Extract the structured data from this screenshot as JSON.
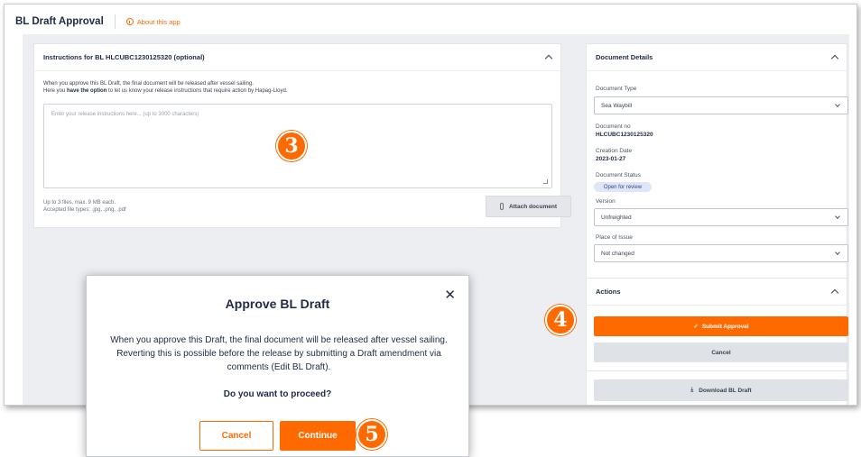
{
  "app": {
    "title": "BL Draft Approval",
    "about_link": "About this app",
    "accent_color": "#ff6a00"
  },
  "instructions": {
    "header": "Instructions for BL HLCUBC1230125320 (optional)",
    "line1": "When you approve this BL Draft, the final document will be released after vessel sailing.",
    "line2_pre": "Here you ",
    "line2_bold": "have the option",
    "line2_post": " to let us know your release instructions that require action by Hapag-Lloyd.",
    "placeholder": "Enter your release instructions here... (up to 3000 characters)",
    "files_note_1": "Up to 3 files, max. 9 MB each.",
    "files_note_2": "Accepted file types: .jpg, .png, .pdf",
    "attach_label": "Attach document"
  },
  "details": {
    "header": "Document Details",
    "doc_type_label": "Document Type",
    "doc_type_value": "Sea Waybill",
    "doc_no_label": "Document no",
    "doc_no_value": "HLCUBC1230125320",
    "creation_label": "Creation Date",
    "creation_value": "2023-01-27",
    "status_label": "Document Status",
    "status_value": "Open for review",
    "version_label": "Version",
    "version_value": "Unfreighted",
    "place_label": "Place of Issue",
    "place_value": "Not changed"
  },
  "actions": {
    "header": "Actions",
    "submit_label": "Submit Approval",
    "cancel_label": "Cancel",
    "download_label": "Download BL Draft"
  },
  "modal": {
    "title": "Approve BL Draft",
    "body": "When you approve this Draft, the final document will be released after vessel sailing. Reverting this is possible before the release by submitting a Draft amendment via comments (Edit BL Draft).",
    "question": "Do you want to proceed?",
    "cancel_label": "Cancel",
    "continue_label": "Continue"
  },
  "markers": {
    "step3": "3",
    "step4": "4",
    "step5": "5"
  }
}
